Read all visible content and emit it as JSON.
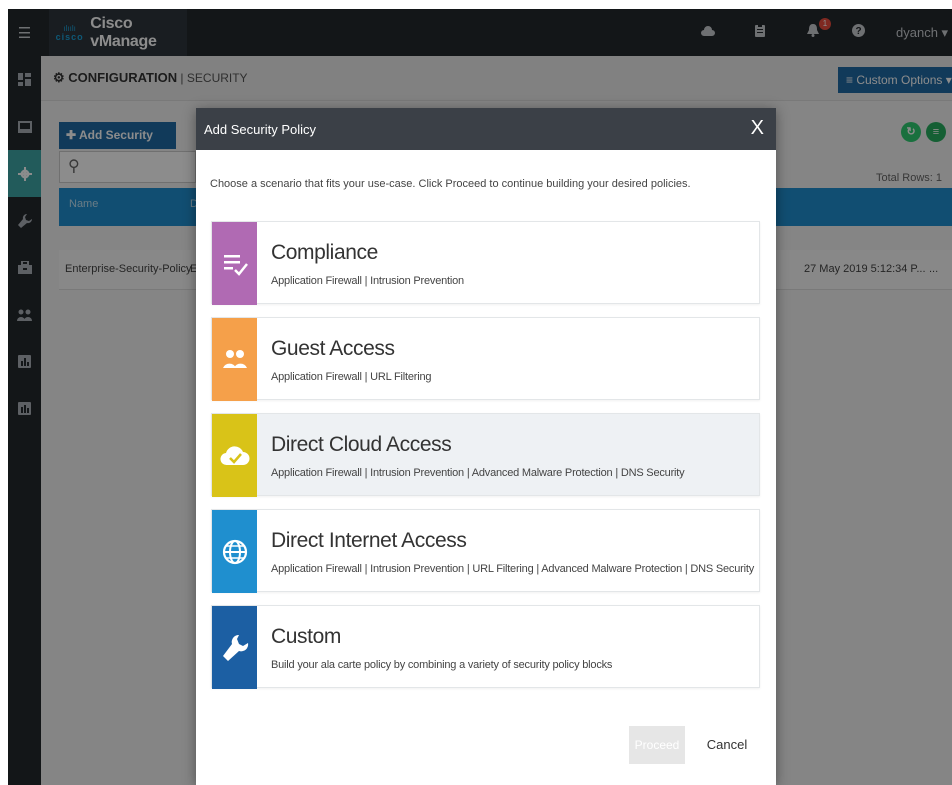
{
  "topbar": {
    "brand_logo": "cisco",
    "brand_name": "Cisco vManage",
    "notification_count": "1",
    "user": "dyanch ▾",
    "icons": [
      "menu-icon",
      "cloud-icon",
      "clipboard-icon",
      "bell-icon",
      "help-icon"
    ]
  },
  "leftnav": {
    "items": [
      "dashboard-icon",
      "monitor-icon",
      "gear-icon",
      "wrench-icon",
      "toolbox-icon",
      "users-icon",
      "analytics-icon",
      "reports-icon"
    ],
    "active": "gear-icon"
  },
  "pageheader": {
    "title": "CONFIGURATION",
    "separator": " | ",
    "subtitle": "SECURITY",
    "custom_options": "≡ Custom Options ▾"
  },
  "background": {
    "add_button": "Add Security Policy",
    "search_icon": "search-icon",
    "total_rows": "Total Rows: 1",
    "columns": [
      "Name",
      "D"
    ],
    "row": {
      "name": "Enterprise-Security-Policy",
      "desc": "Er",
      "updated": "27 May 2019 5:12:34 P...",
      "actions": "..."
    }
  },
  "modal": {
    "title": "Add Security Policy",
    "close": "X",
    "description": "Choose a scenario that fits your use-case. Click Proceed to continue building your desired policies.",
    "options": [
      {
        "title": "Compliance",
        "subtitle": "Application Firewall | Intrusion Prevention",
        "color": "#b06ab3",
        "icon": "checklist-icon"
      },
      {
        "title": "Guest Access",
        "subtitle": "Application Firewall | URL Filtering",
        "color": "#f5a04a",
        "icon": "users-icon"
      },
      {
        "title": "Direct Cloud Access",
        "subtitle": "Application Firewall | Intrusion Prevention | Advanced Malware Protection | DNS Security",
        "color": "#d9c318",
        "icon": "cloud-check-icon"
      },
      {
        "title": "Direct Internet Access",
        "subtitle": "Application Firewall | Intrusion Prevention | URL Filtering | Advanced Malware Protection | DNS Security",
        "color": "#1f8fcf",
        "icon": "globe-icon"
      },
      {
        "title": "Custom",
        "subtitle": "Build your ala carte policy by combining a variety of security policy blocks",
        "color": "#1c5fa3",
        "icon": "wrench-icon"
      }
    ],
    "highlighted_option": "Direct Cloud Access",
    "proceed": "Proceed",
    "cancel": "Cancel"
  },
  "colors": {
    "topbar": "#23282d",
    "accent": "#1f6aa5",
    "active_nav": "#3fa6a6",
    "table_header": "#1f8fcf",
    "refresh_button": "#2ecc71",
    "list_button": "#27ae60"
  }
}
